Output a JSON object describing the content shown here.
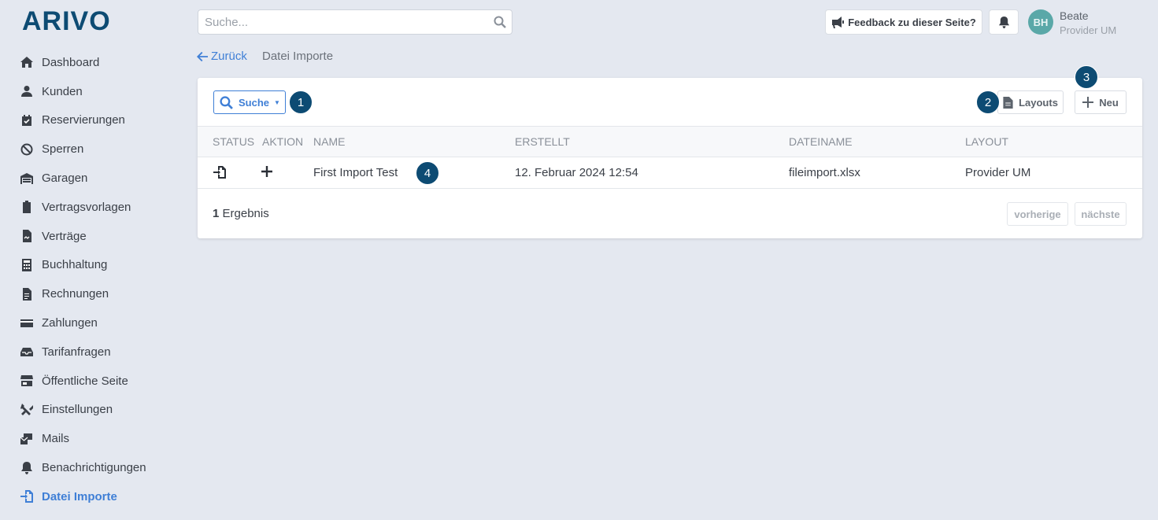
{
  "brand": {
    "logo_text": "ARIVO",
    "color": "#0d4b73"
  },
  "sidebar": {
    "items": [
      {
        "label": "Dashboard",
        "icon": "home-icon"
      },
      {
        "label": "Kunden",
        "icon": "user-icon"
      },
      {
        "label": "Reservierungen",
        "icon": "calendar-check-icon"
      },
      {
        "label": "Sperren",
        "icon": "ban-icon"
      },
      {
        "label": "Garagen",
        "icon": "warehouse-icon"
      },
      {
        "label": "Vertragsvorlagen",
        "icon": "clipboard-icon"
      },
      {
        "label": "Verträge",
        "icon": "file-contract-icon"
      },
      {
        "label": "Buchhaltung",
        "icon": "calculator-icon"
      },
      {
        "label": "Rechnungen",
        "icon": "file-invoice-icon"
      },
      {
        "label": "Zahlungen",
        "icon": "credit-card-icon"
      },
      {
        "label": "Tarifanfragen",
        "icon": "inbox-icon"
      },
      {
        "label": "Öffentliche Seite",
        "icon": "store-icon"
      },
      {
        "label": "Einstellungen",
        "icon": "tools-icon"
      },
      {
        "label": "Mails",
        "icon": "mail-bulk-icon"
      },
      {
        "label": "Benachrichtigungen",
        "icon": "bell-icon"
      },
      {
        "label": "Datei Importe",
        "icon": "file-import-icon",
        "active": true
      }
    ]
  },
  "topbar": {
    "search_placeholder": "Suche...",
    "feedback_label": "Feedback zu dieser Seite?",
    "user_initials": "BH",
    "user_name": "Beate",
    "user_role": "Provider UM"
  },
  "breadcrumb": {
    "back_label": "Zurück",
    "current": "Datei Importe"
  },
  "toolbar": {
    "search_label": "Suche",
    "layouts_label": "Layouts",
    "new_label": "Neu"
  },
  "table": {
    "columns": [
      "STATUS",
      "AKTION",
      "NAME",
      "ERSTELLT",
      "DATEINAME",
      "LAYOUT"
    ],
    "rows": [
      {
        "name": "First Import Test",
        "created": "12. Februar 2024 12:54",
        "filename": "fileimport.xlsx",
        "layout": "Provider UM"
      }
    ]
  },
  "footer": {
    "result_count": "1",
    "result_label": "Ergebnis",
    "prev_label": "vorherige",
    "next_label": "nächste"
  },
  "badges": [
    "1",
    "2",
    "3",
    "4"
  ],
  "colors": {
    "accent": "#3f7fd6",
    "badge": "#0d4b73",
    "avatar": "#5aa8a8",
    "background": "#e4e8f0"
  }
}
